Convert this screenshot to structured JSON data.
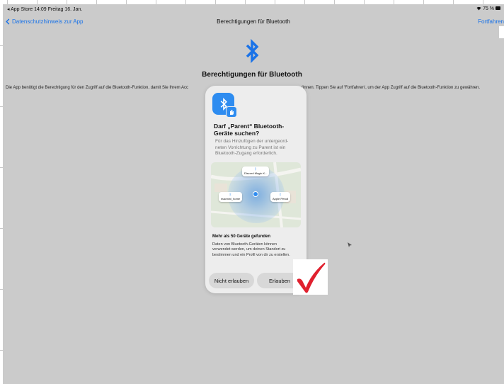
{
  "status_bar": {
    "left": "◂ App Store  14:09  Freitag 16. Jan.",
    "right": "75 %"
  },
  "nav": {
    "back_label": "Datenschutzhinweis zur App",
    "title": "Berechtigungen für Bluetooth",
    "next_label": "Fortfahren"
  },
  "page": {
    "heading": "Berechtigungen für Bluetooth",
    "description_left": "Die App benötigt die Berechtigung für den Zugriff auf die Bluetooth-Funktion, damit Sie Ihrem Acc",
    "description_right": "önnen. Tippen Sie auf 'Fortfahren', um der App Zugriff auf die Bluetooth-Funktion zu gewähren."
  },
  "alert": {
    "title": "Darf „Parent“ Bluetooth-Geräte suchen?",
    "message": "Für das Hinzufügen der untergeord-neten Vorrichtung zu Parent ist ein Bluetooth-Zugang erforderlich.",
    "devices": [
      "Discord Magic K...",
      "macmini_home",
      "Apple Pencil"
    ],
    "found_title": "Mehr als 50 Geräte gefunden",
    "found_message": "Daten von Bluetooth-Geräten können verwendet werden, um deinen Standort zu bestimmen und ein Profil von dir zu erstellen.",
    "deny_label": "Nicht erlauben",
    "allow_label": "Erlauben"
  },
  "colors": {
    "accent": "#1a73e8",
    "bluetooth_blue": "#2e8cf0",
    "checkmark_red": "#e0202e",
    "background": "#cbcbcb"
  },
  "icons": [
    "bluetooth-icon",
    "chevron-left-icon",
    "wifi-icon",
    "battery-icon",
    "hand-icon",
    "checkmark-icon",
    "cursor-icon"
  ]
}
